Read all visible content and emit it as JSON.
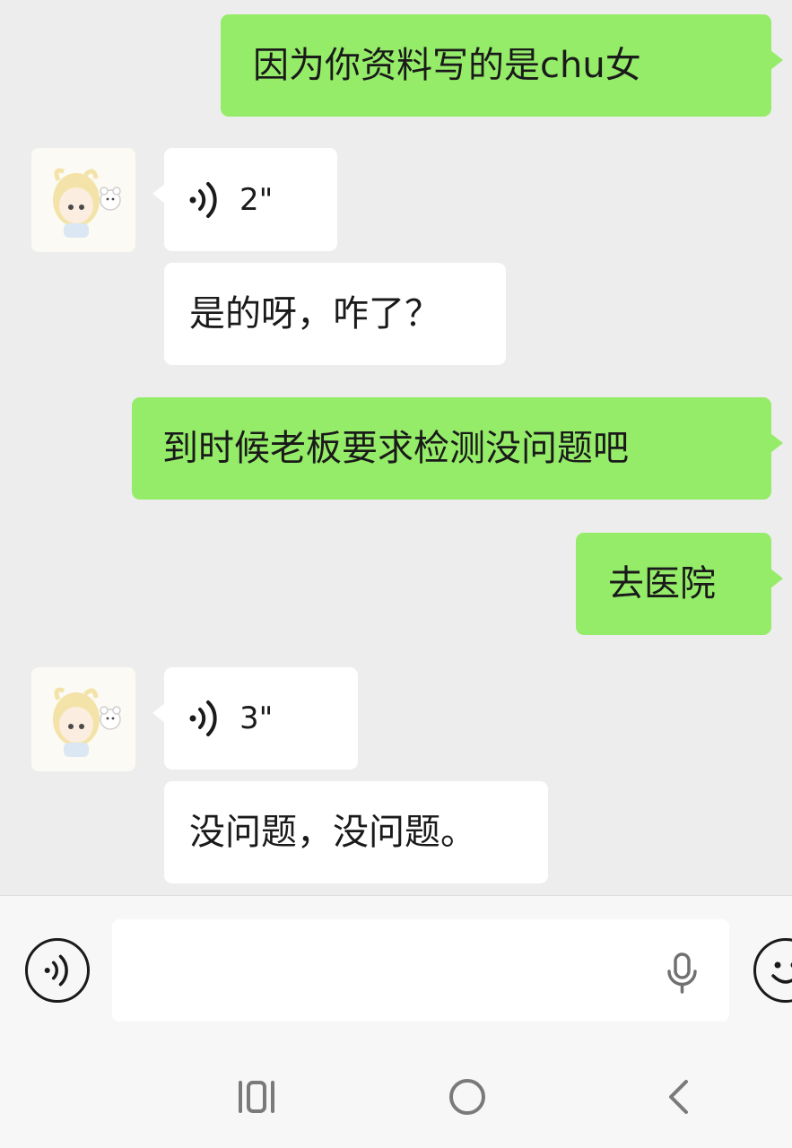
{
  "messages": [
    {
      "id": "m1",
      "direction": "out",
      "type": "text",
      "text": "因为你资料写的是chu女"
    },
    {
      "id": "m2",
      "direction": "in",
      "type": "voice",
      "duration": "2\""
    },
    {
      "id": "m3",
      "direction": "in",
      "type": "text",
      "text": "是的呀，咋了？"
    },
    {
      "id": "m4",
      "direction": "out",
      "type": "text",
      "text": "到时候老板要求检测没问题吧"
    },
    {
      "id": "m5",
      "direction": "out",
      "type": "text",
      "text": "去医院"
    },
    {
      "id": "m6",
      "direction": "in",
      "type": "voice",
      "duration": "3\""
    },
    {
      "id": "m7",
      "direction": "in",
      "type": "text",
      "text": "没问题，没问题。"
    }
  ],
  "input_bar": {
    "value": "",
    "icons": {
      "left": "voice-mode-icon",
      "mic": "microphone-icon",
      "right": "emoji-icon"
    }
  },
  "nav_bar": {
    "icons": [
      "recent-apps-icon",
      "home-icon",
      "back-icon"
    ]
  },
  "colors": {
    "chat_background": "#ededed",
    "outgoing_bubble": "#95ec69",
    "incoming_bubble": "#ffffff",
    "bottom_bar": "#f7f7f7"
  }
}
